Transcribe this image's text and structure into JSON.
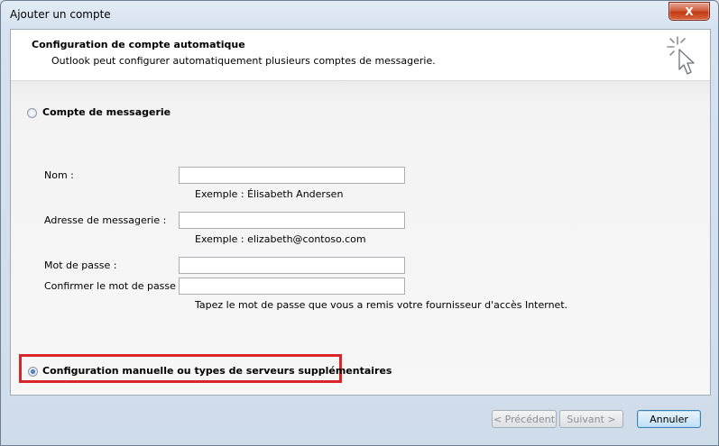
{
  "window": {
    "title": "Ajouter un compte",
    "close_glyph": "X"
  },
  "header": {
    "title": "Configuration de compte automatique",
    "subtitle": "Outlook peut configurer automatiquement plusieurs comptes de messagerie.",
    "icon": "wizard-cursor-icon"
  },
  "options": {
    "email_account": {
      "label": "Compte de messagerie",
      "checked": false
    },
    "manual_config": {
      "label": "Configuration manuelle ou types de serveurs supplémentaires",
      "checked": true
    }
  },
  "form": {
    "name": {
      "label": "Nom :",
      "value": "",
      "hint": "Exemple : Élisabeth Andersen"
    },
    "email": {
      "label": "Adresse de messagerie :",
      "value": "",
      "hint": "Exemple : elizabeth@contoso.com"
    },
    "password": {
      "label": "Mot de passe :",
      "value": ""
    },
    "confirm_password": {
      "label": "Confirmer le mot de passe :",
      "value": "",
      "hint": "Tapez le mot de passe que vous a remis votre fournisseur d'accès Internet."
    }
  },
  "buttons": {
    "previous": "< Précédent",
    "next": "Suivant >",
    "cancel": "Annuler"
  },
  "colors": {
    "highlight_border": "#d9262b",
    "close_button": "#c23a12"
  }
}
